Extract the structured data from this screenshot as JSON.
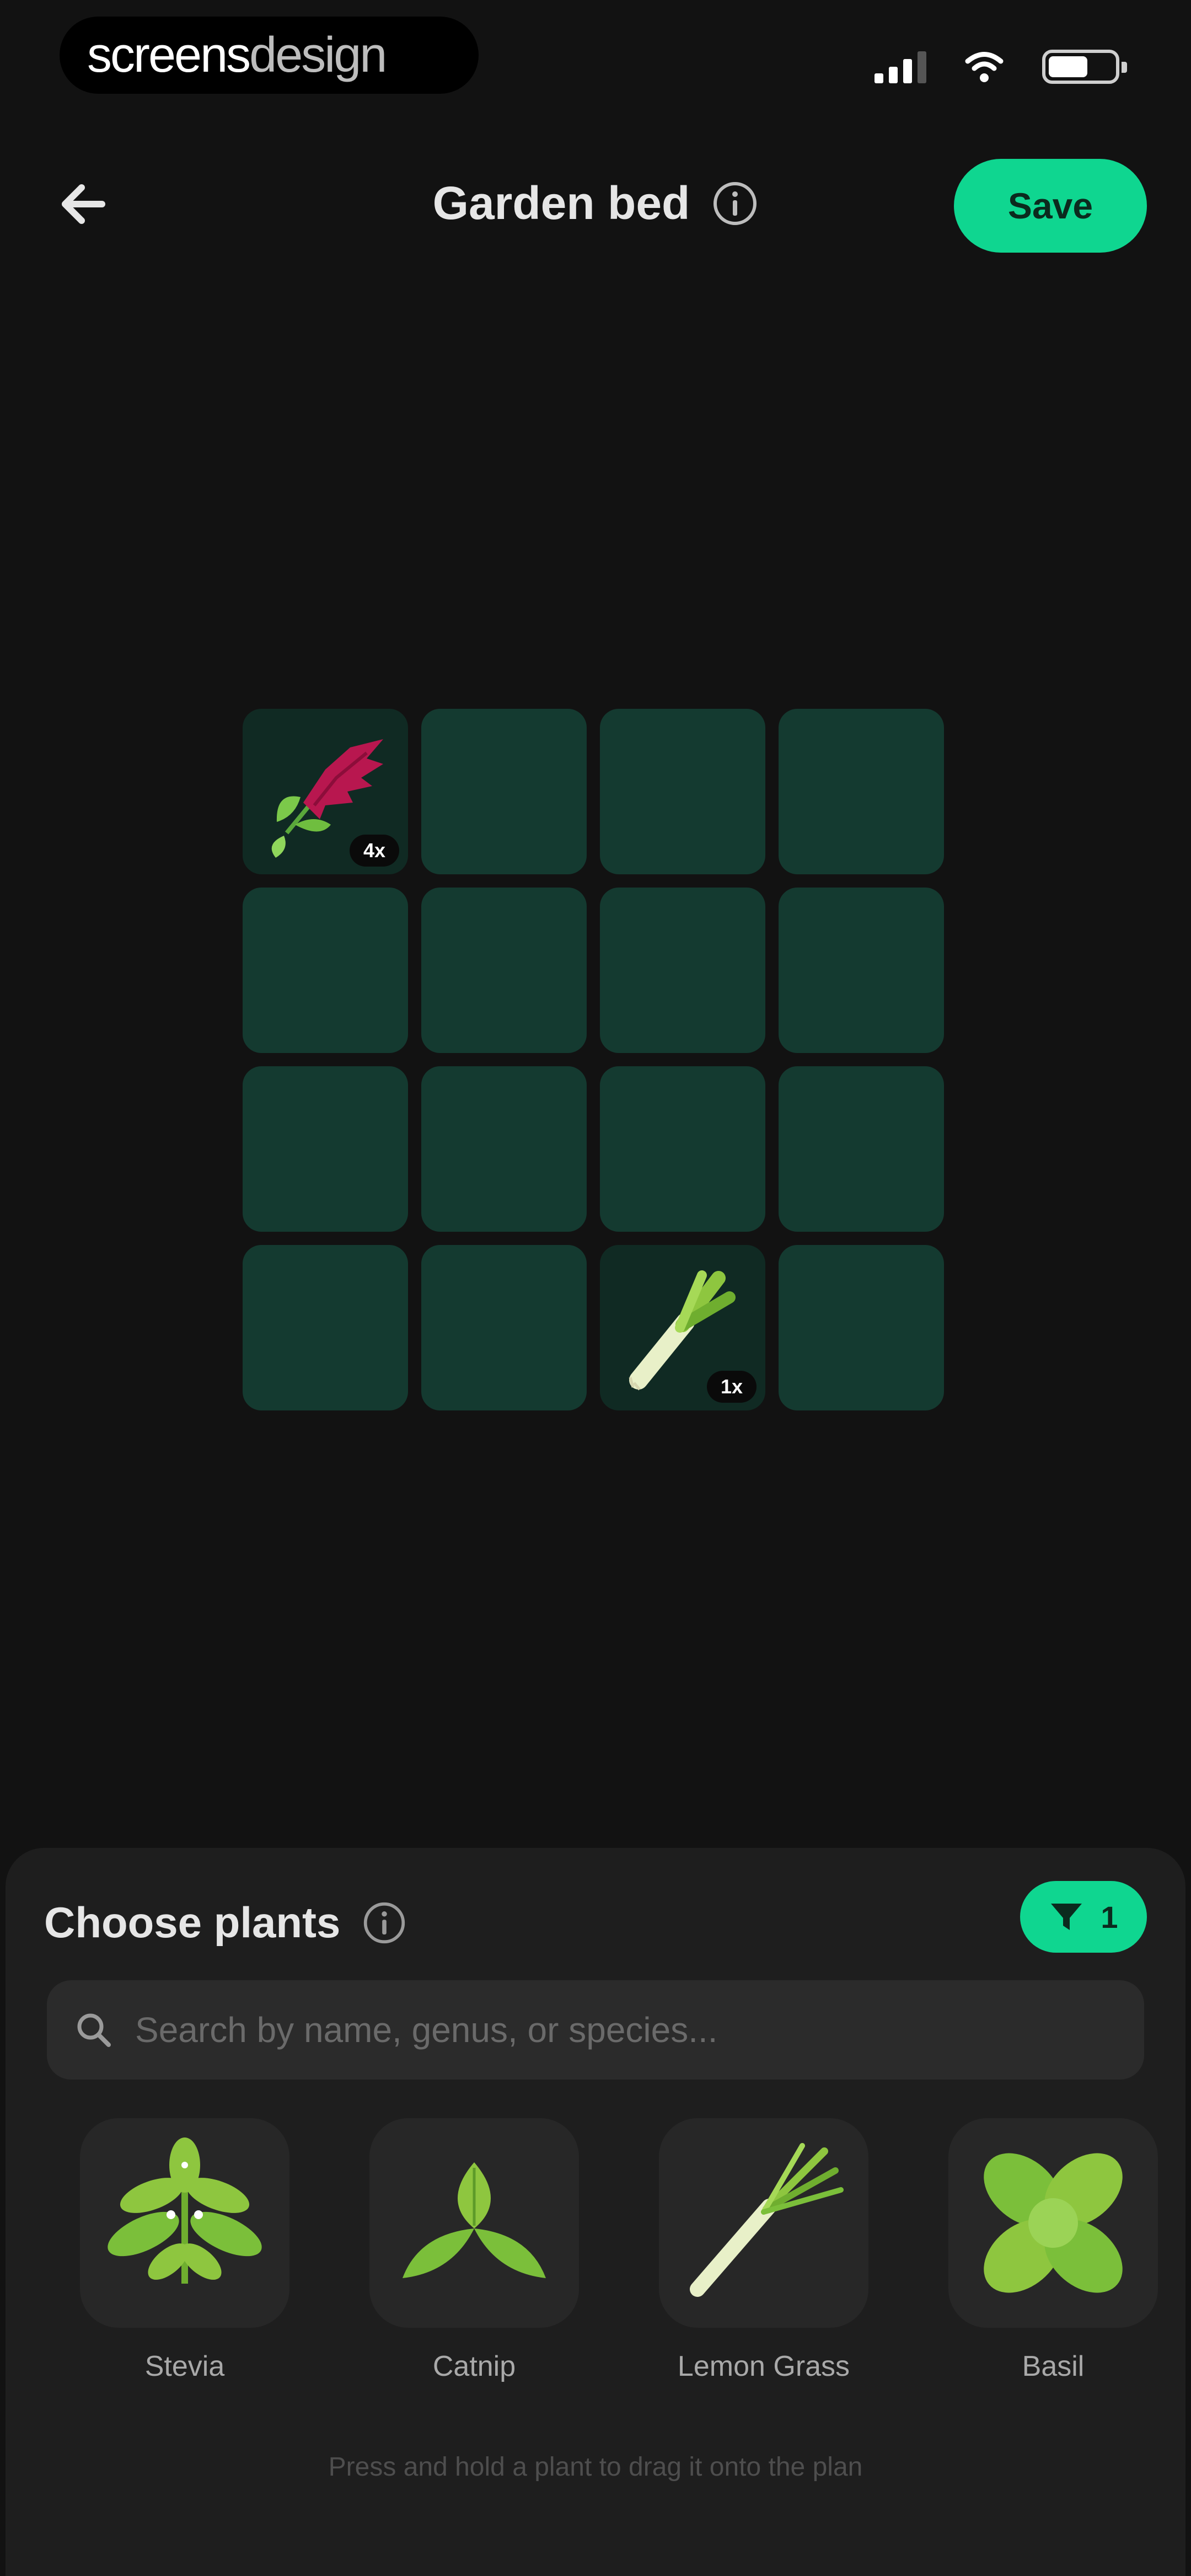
{
  "watermark": {
    "part1": "screens",
    "part2": "design"
  },
  "header": {
    "title": "Garden bed",
    "save_label": "Save"
  },
  "grid": {
    "rows": 4,
    "cols": 4,
    "cells": [
      {
        "plant": "amaranth-icon",
        "count": "4x"
      },
      {},
      {},
      {},
      {},
      {},
      {},
      {},
      {},
      {},
      {},
      {},
      {},
      {},
      {
        "plant": "leek-icon",
        "count": "1x"
      },
      {}
    ]
  },
  "sheet": {
    "title": "Choose plants",
    "filter_count": "1",
    "search_placeholder": "Search by name, genus, or species...",
    "plants": [
      {
        "name": "Stevia",
        "icon": "stevia-icon"
      },
      {
        "name": "Catnip",
        "icon": "catnip-icon"
      },
      {
        "name": "Lemon Grass",
        "icon": "lemon-grass-icon"
      },
      {
        "name": "Basil",
        "icon": "basil-icon"
      }
    ],
    "hint": "Press and hold a plant to drag it onto the plan"
  },
  "colors": {
    "accent": "#0fd690",
    "cell": "#143a30",
    "background": "#121212"
  }
}
